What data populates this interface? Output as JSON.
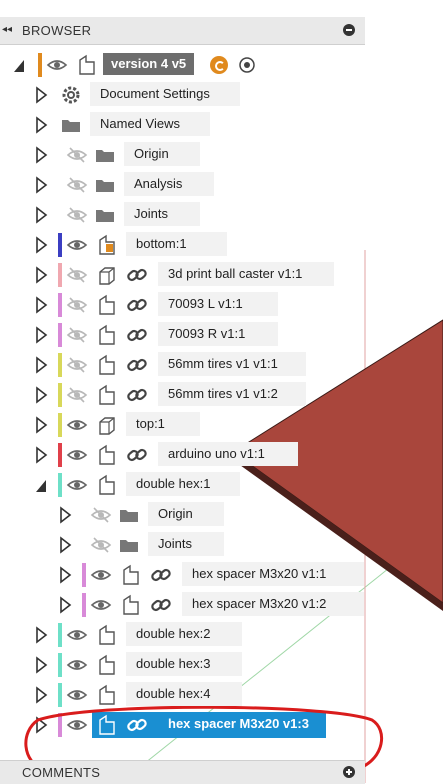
{
  "browser": {
    "title": "BROWSER",
    "root": {
      "label": "version 4 v5"
    },
    "rows": [
      {
        "label": "Document Settings",
        "icon": "gear-icon",
        "bar": null,
        "eye": null,
        "link": false,
        "expanded": false
      },
      {
        "label": "Named Views",
        "icon": "folder-icon",
        "bar": null,
        "eye": null,
        "link": false,
        "expanded": false
      },
      {
        "label": "Origin",
        "icon": "folder-icon",
        "bar": null,
        "eye": "hidden",
        "link": false,
        "expanded": false
      },
      {
        "label": "Analysis",
        "icon": "folder-icon",
        "bar": null,
        "eye": "hidden",
        "link": false,
        "expanded": false
      },
      {
        "label": "Joints",
        "icon": "folder-icon",
        "bar": null,
        "eye": "hidden",
        "link": false,
        "expanded": false
      },
      {
        "label": "bottom:1",
        "icon": "component-active-icon",
        "bar": "#3b3ec2",
        "eye": "visible",
        "link": false,
        "expanded": false
      },
      {
        "label": "3d print ball caster v1:1",
        "icon": "body-icon",
        "bar": "#f0a8b0",
        "eye": "hidden",
        "link": true,
        "expanded": false
      },
      {
        "label": "70093 L v1:1",
        "icon": "component-icon",
        "bar": "#d88ad8",
        "eye": "hidden",
        "link": true,
        "expanded": false
      },
      {
        "label": "70093 R  v1:1",
        "icon": "component-icon",
        "bar": "#d88ad8",
        "eye": "hidden",
        "link": true,
        "expanded": false
      },
      {
        "label": "56mm tires v1 v1:1",
        "icon": "component-icon",
        "bar": "#d8d85a",
        "eye": "hidden",
        "link": true,
        "expanded": false
      },
      {
        "label": "56mm tires v1 v1:2",
        "icon": "component-icon",
        "bar": "#d8d85a",
        "eye": "hidden",
        "link": true,
        "expanded": false
      },
      {
        "label": "top:1",
        "icon": "body-icon",
        "bar": "#d8d85a",
        "eye": "visible",
        "link": false,
        "expanded": false
      },
      {
        "label": "arduino uno v1:1",
        "icon": "component-icon",
        "bar": "#e0404a",
        "eye": "visible",
        "link": true,
        "expanded": false
      },
      {
        "label": "double hex:1",
        "icon": "component-icon",
        "bar": "#6ee0c8",
        "eye": "visible",
        "link": false,
        "expanded": true
      },
      {
        "label": "Origin",
        "icon": "folder-icon",
        "bar": null,
        "eye": "hidden",
        "link": false,
        "expanded": false,
        "indent": 1
      },
      {
        "label": "Joints",
        "icon": "folder-icon",
        "bar": null,
        "eye": "hidden",
        "link": false,
        "expanded": false,
        "indent": 1
      },
      {
        "label": "hex spacer M3x20 v1:1",
        "icon": "component-icon",
        "bar": "#d88ad8",
        "eye": "visible",
        "link": true,
        "expanded": false,
        "indent": 1
      },
      {
        "label": "hex spacer M3x20 v1:2",
        "icon": "component-icon",
        "bar": "#d88ad8",
        "eye": "visible",
        "link": true,
        "expanded": false,
        "indent": 1
      },
      {
        "label": "double hex:2",
        "icon": "component-icon",
        "bar": "#6ee0c8",
        "eye": "visible",
        "link": false,
        "expanded": false
      },
      {
        "label": "double hex:3",
        "icon": "component-icon",
        "bar": "#6ee0c8",
        "eye": "visible",
        "link": false,
        "expanded": false
      },
      {
        "label": "double hex:4",
        "icon": "component-icon",
        "bar": "#6ee0c8",
        "eye": "visible",
        "link": false,
        "expanded": false
      },
      {
        "label": "hex spacer M3x20 v1:3",
        "icon": "component-icon",
        "bar": "#d88ad8",
        "eye": "visible",
        "link": true,
        "expanded": false,
        "selected": true
      }
    ]
  },
  "comments": {
    "title": "COMMENTS"
  },
  "colors": {
    "selection": "#1a8fd2",
    "annotation": "#d91c1c",
    "plate": "#a9463c"
  }
}
